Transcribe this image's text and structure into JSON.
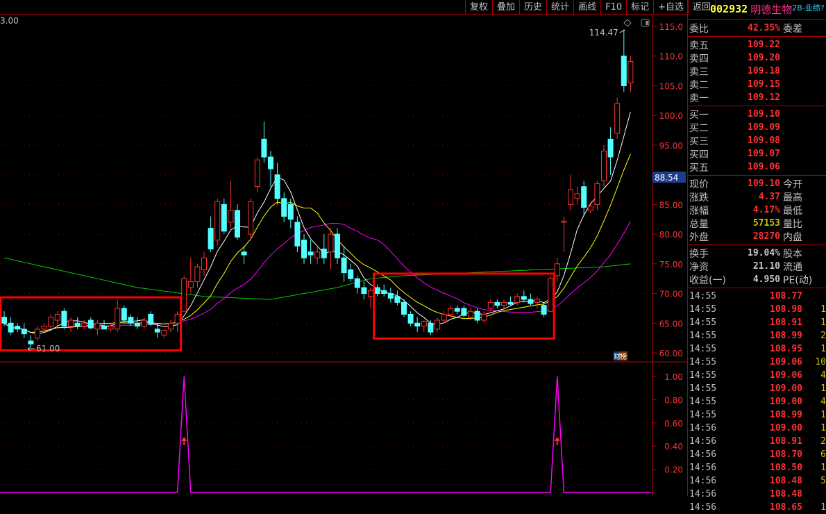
{
  "toolbar": [
    "复权",
    "叠加",
    "历史",
    "统计",
    "画线",
    "F10",
    "标记",
    "+自选",
    "返回"
  ],
  "stock": {
    "code": "002932",
    "name": "明德生物",
    "tag": "2B-业绩?"
  },
  "quote": {
    "weibi": {
      "label": "委比",
      "value": "42.35%",
      "right": "委差"
    },
    "sell": [
      {
        "label": "卖五",
        "price": "109.22"
      },
      {
        "label": "卖四",
        "price": "109.20"
      },
      {
        "label": "卖三",
        "price": "109.18"
      },
      {
        "label": "卖二",
        "price": "109.15"
      },
      {
        "label": "卖一",
        "price": "109.12"
      }
    ],
    "buy": [
      {
        "label": "买一",
        "price": "109.10"
      },
      {
        "label": "买二",
        "price": "109.09"
      },
      {
        "label": "买三",
        "price": "109.08"
      },
      {
        "label": "买四",
        "price": "109.07"
      },
      {
        "label": "买五",
        "price": "109.06"
      }
    ],
    "stats": [
      {
        "label": "现价",
        "value": "109.10",
        "right": "今开",
        "color": "red"
      },
      {
        "label": "涨跌",
        "value": "4.37",
        "right": "最高",
        "color": "red"
      },
      {
        "label": "涨幅",
        "value": "4.17%",
        "right": "最低",
        "color": "red"
      },
      {
        "label": "总量",
        "value": "57153",
        "right": "量比",
        "color": "yel"
      },
      {
        "label": "外盘",
        "value": "28270",
        "right": "内盘",
        "color": "red"
      }
    ],
    "stats2": [
      {
        "label": "换手",
        "value": "19.04%",
        "right": "股本"
      },
      {
        "label": "净资",
        "value": "21.10",
        "right": "流通"
      },
      {
        "label": "收益(一)",
        "value": "4.950",
        "right": "PE(动)"
      }
    ]
  },
  "ticks": [
    [
      "14:55",
      "108.77",
      ""
    ],
    [
      "14:55",
      "108.98",
      "1"
    ],
    [
      "14:55",
      "108.91",
      "1"
    ],
    [
      "14:55",
      "108.99",
      "2"
    ],
    [
      "14:55",
      "108.95",
      "1"
    ],
    [
      "14:55",
      "109.06",
      "10"
    ],
    [
      "14:55",
      "109.06",
      "4"
    ],
    [
      "14:55",
      "109.00",
      "1"
    ],
    [
      "14:55",
      "109.00",
      "4"
    ],
    [
      "14:55",
      "108.99",
      "1"
    ],
    [
      "14:56",
      "109.00",
      "1"
    ],
    [
      "14:56",
      "108.91",
      "2"
    ],
    [
      "14:56",
      "108.70",
      "6"
    ],
    [
      "14:56",
      "108.50",
      "1"
    ],
    [
      "14:56",
      "108.48",
      "5"
    ],
    [
      "14:56",
      "108.48",
      ""
    ],
    [
      "14:56",
      "108.65",
      "1"
    ]
  ],
  "chart_labels": {
    "top_left": "3.00",
    "high": "114.47",
    "low": "61.00",
    "current_tag": "88.54",
    "badge": [
      "财",
      "榜"
    ]
  },
  "price_axis": [
    "115.0",
    "110.0",
    "105.0",
    "100.0",
    "95.00",
    "90.00",
    "85.00",
    "80.00",
    "75.00",
    "70.00",
    "65.00",
    "60.00"
  ],
  "ind_axis": [
    "1.00",
    "0.80",
    "0.60",
    "0.40",
    "0.20"
  ],
  "colors": {
    "up": "#ff3232",
    "down": "#54ffff",
    "ma5": "#ffffff",
    "ma10": "#ffff00",
    "ma20": "#ff00ff",
    "ma60": "#00d000",
    "axis": "#c00000"
  },
  "chart_data": {
    "type": "candlestick",
    "price_range": [
      60,
      115
    ],
    "candles": [
      [
        66,
        67,
        64.5,
        65
      ],
      [
        65,
        66,
        63,
        63.5
      ],
      [
        64.5,
        65,
        63.5,
        64
      ],
      [
        64,
        65,
        62.5,
        63.2
      ],
      [
        62,
        63,
        61,
        61.5
      ],
      [
        62.5,
        64.5,
        62,
        64
      ],
      [
        64,
        65,
        63.5,
        64.5
      ],
      [
        64.5,
        66.5,
        64,
        66
      ],
      [
        65.5,
        67,
        64.5,
        66.5
      ],
      [
        67,
        67.5,
        64,
        64.5
      ],
      [
        64.5,
        66,
        63.5,
        65.5
      ],
      [
        65,
        66,
        64,
        64.5
      ],
      [
        64.5,
        65.5,
        64,
        65
      ],
      [
        65.5,
        66,
        64,
        64.2
      ],
      [
        64,
        65.5,
        63,
        65
      ],
      [
        64.5,
        65.5,
        64,
        64
      ],
      [
        64,
        65,
        63.5,
        64.5
      ],
      [
        64,
        69,
        63.5,
        67.5
      ],
      [
        67.5,
        68,
        65,
        65.5
      ],
      [
        66,
        66.5,
        64.5,
        65
      ],
      [
        65,
        66,
        64,
        64.5
      ],
      [
        64.5,
        66,
        64,
        65.5
      ],
      [
        66.5,
        67,
        64.5,
        64.8
      ],
      [
        64,
        65,
        62.5,
        63.5
      ],
      [
        63,
        64,
        62.5,
        63.8
      ],
      [
        64,
        65.5,
        63.5,
        65
      ],
      [
        65,
        67,
        63.5,
        66.5
      ],
      [
        67,
        73,
        67,
        72.5
      ],
      [
        71,
        76,
        70,
        72
      ],
      [
        72,
        75,
        71,
        74.5
      ],
      [
        74,
        77,
        73,
        76
      ],
      [
        81,
        83,
        77,
        77.5
      ],
      [
        79,
        86,
        78,
        85.5
      ],
      [
        85,
        86,
        80,
        80.5
      ],
      [
        82,
        89,
        81,
        84
      ],
      [
        84,
        85,
        79,
        79.5
      ],
      [
        77,
        78,
        75,
        76.5
      ],
      [
        80,
        86,
        79,
        85.5
      ],
      [
        88,
        93,
        87,
        92.5
      ],
      [
        96,
        99,
        92,
        93
      ],
      [
        93,
        94,
        88,
        91
      ],
      [
        90,
        92,
        85,
        86
      ],
      [
        86,
        87,
        82,
        83
      ],
      [
        85,
        86,
        81,
        82.5
      ],
      [
        82,
        83,
        77,
        78
      ],
      [
        79,
        80,
        75,
        76
      ],
      [
        77,
        79,
        75,
        76.5
      ],
      [
        76,
        78,
        75,
        77
      ],
      [
        77.5,
        80,
        75,
        76
      ],
      [
        77,
        81,
        74,
        80
      ],
      [
        80,
        81,
        75,
        76
      ],
      [
        76,
        78,
        72,
        73.5
      ],
      [
        74,
        75,
        72,
        72.5
      ],
      [
        72.5,
        73,
        70,
        71
      ],
      [
        71,
        72,
        69,
        70
      ],
      [
        69.5,
        71,
        67.5,
        70.5
      ],
      [
        71,
        71.5,
        69.5,
        70
      ],
      [
        70.5,
        71.5,
        69.5,
        70
      ],
      [
        70,
        71,
        68.5,
        69.2
      ],
      [
        69.5,
        70.5,
        68,
        68.5
      ],
      [
        68.5,
        69,
        66,
        66.5
      ],
      [
        66.5,
        67,
        64.5,
        65
      ],
      [
        65,
        66,
        63.5,
        64.5
      ],
      [
        64.5,
        65.5,
        63.5,
        65.3
      ],
      [
        65,
        65.5,
        63,
        63.5
      ],
      [
        64,
        66,
        63.5,
        65.5
      ],
      [
        65.5,
        67,
        65,
        66.5
      ],
      [
        66.5,
        68,
        66,
        67.5
      ],
      [
        67.5,
        68,
        66.5,
        67
      ],
      [
        67.5,
        68,
        66,
        66.3
      ],
      [
        66,
        67.5,
        65.5,
        67
      ],
      [
        67,
        67.5,
        65,
        65.5
      ],
      [
        65.5,
        67,
        65,
        66.5
      ],
      [
        67.5,
        69,
        67,
        68.5
      ],
      [
        68.5,
        69,
        67.5,
        68
      ],
      [
        68,
        69,
        67.5,
        68.5
      ],
      [
        68.5,
        69.5,
        68,
        68.2
      ],
      [
        68.5,
        70,
        68,
        69.5
      ],
      [
        69.5,
        70.5,
        68.5,
        69
      ],
      [
        69,
        70,
        68,
        68.3
      ],
      [
        68.5,
        69.5,
        67.5,
        69
      ],
      [
        68,
        68.5,
        66,
        66.5
      ],
      [
        67,
        73,
        67,
        72.5
      ],
      [
        73,
        76,
        72,
        75
      ],
      [
        82,
        83,
        77,
        82.2
      ],
      [
        85,
        90,
        84,
        87.5
      ],
      [
        86,
        88,
        85,
        86.8
      ],
      [
        88,
        89,
        83,
        84.5
      ],
      [
        84,
        85,
        83.5,
        84.7
      ],
      [
        85,
        89,
        84,
        88.5
      ],
      [
        89,
        95,
        88,
        94
      ],
      [
        96,
        98,
        90,
        93
      ],
      [
        97,
        103,
        96,
        102
      ],
      [
        110,
        114.5,
        104,
        105
      ],
      [
        105.5,
        110,
        104,
        109.1
      ]
    ],
    "ma60_points": [
      [
        0,
        76
      ],
      [
        10,
        73.5
      ],
      [
        20,
        71
      ],
      [
        30,
        69.5
      ],
      [
        40,
        69
      ],
      [
        50,
        71
      ],
      [
        55,
        72.5
      ],
      [
        60,
        73
      ],
      [
        70,
        73.5
      ],
      [
        80,
        74
      ],
      [
        90,
        74.5
      ],
      [
        94,
        75
      ]
    ],
    "indicator": {
      "range": [
        0,
        1
      ],
      "spikes": [
        27,
        83
      ]
    },
    "highlight_boxes": [
      [
        0,
        26
      ],
      [
        56,
        82
      ]
    ]
  }
}
